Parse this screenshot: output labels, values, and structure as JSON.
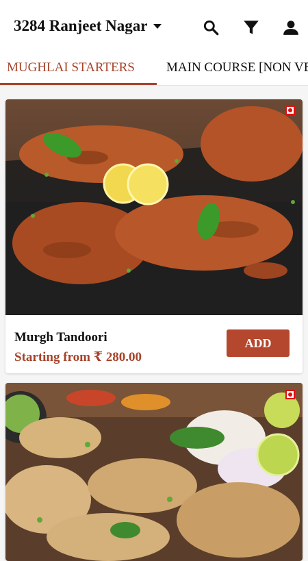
{
  "header": {
    "location": "3284 Ranjeet Nagar",
    "icons": [
      "search-icon",
      "filter-icon",
      "account-icon"
    ]
  },
  "tabs": [
    {
      "label": "MUGHLAI STARTERS",
      "active": true
    },
    {
      "label": "MAIN COURSE [NON VEG]",
      "active": false
    }
  ],
  "items": [
    {
      "name": "Murgh Tandoori",
      "price": "Starting from ₹ 280.00",
      "button": "ADD",
      "image": "tandoori-chicken-photo"
    },
    {
      "name": "",
      "price": "",
      "button": "",
      "image": "chicken-malai-tikka-photo"
    }
  ],
  "colors": {
    "accent": "#a5432a",
    "button": "#b4472d",
    "veg_mark": "#dd1111"
  }
}
